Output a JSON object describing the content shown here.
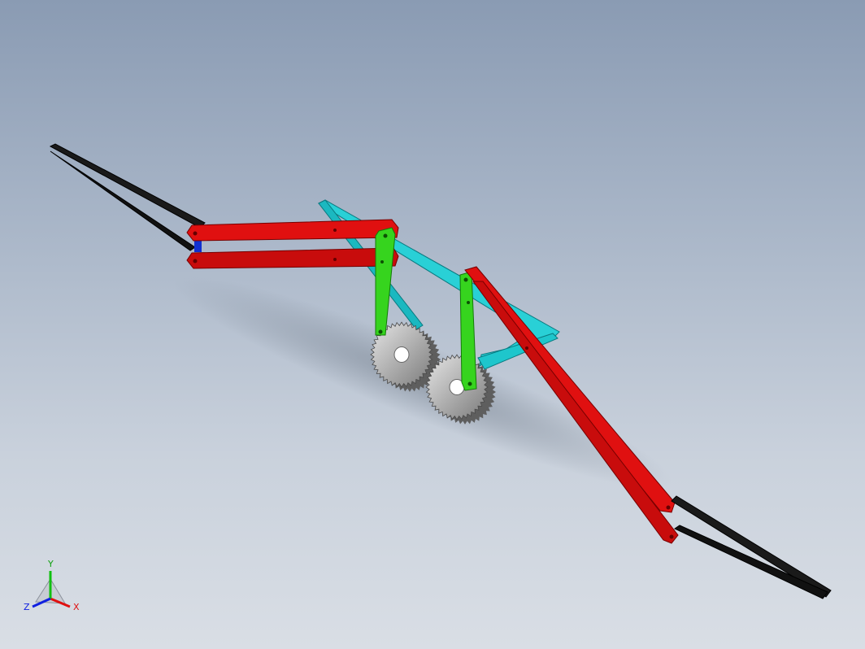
{
  "viewport": {
    "background_top": "#8a9bb3",
    "background_bottom": "#d9dee5"
  },
  "parts": {
    "linkage_color": "#e00000",
    "linkage_dark": "#900000",
    "pusher_color": "#2fd21a",
    "frame_color": "#1fd2d8",
    "arm_color": "#101010",
    "gear_color": "#b8b8b8",
    "gear_teeth": 40
  },
  "triad": {
    "x_label": "X",
    "y_label": "Y",
    "z_label": "Z",
    "x_color": "#e01010",
    "y_color": "#10c010",
    "z_color": "#1020e0"
  }
}
